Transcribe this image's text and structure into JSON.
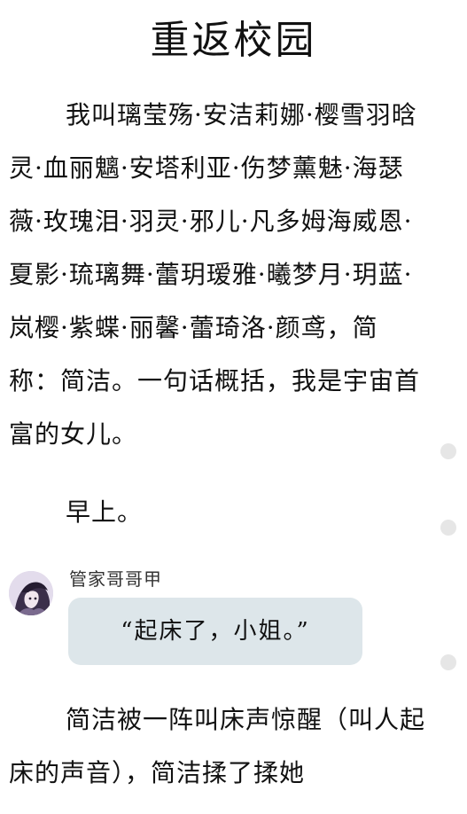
{
  "chapter": {
    "title": "重返校园"
  },
  "story": {
    "paragraph_1": "我叫璃莹殇·安洁莉娜·樱雪羽晗灵·血丽魑·安塔利亚·伤梦薰魅·海瑟薇·玫瑰泪·羽灵·邪儿·凡多姆海威恩·夏影·琉璃舞·蕾玥瑷雅·曦梦月·玥蓝·岚樱·紫蝶·丽馨·蕾琦洛·颜鸢，简称：简洁。一句话概括，我是宇宙首富的女儿。",
    "paragraph_2": "早上。",
    "paragraph_3": "简洁被一阵叫床声惊醒（叫人起床的声音），简洁揉了揉她"
  },
  "dialogue": {
    "speaker_name": "管家哥哥甲",
    "line": "“起床了，小姐。”",
    "avatar_icon": "character-avatar"
  },
  "scroll_indicator": {
    "dot_color": "#e6e6e6"
  }
}
